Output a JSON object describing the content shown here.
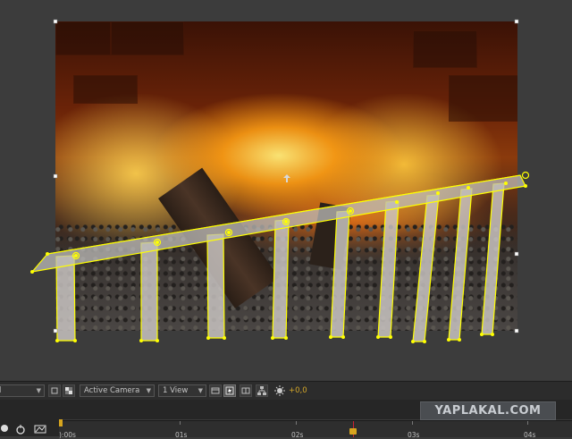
{
  "toolbar": {
    "resolution_value": "l",
    "view_layout_value": "Active Camera",
    "view_count_value": "1 View",
    "exposure_value": "+0,0",
    "icons": [
      "region-of-interest-icon",
      "transparency-grid-icon",
      "view-options-icon",
      "fast-preview-icon",
      "3d-view-icon",
      "flowchart-icon",
      "exposure-icon"
    ]
  },
  "timeline": {
    "ticks": [
      "):00s",
      "01s",
      "02s",
      "03s",
      "04s"
    ],
    "current_time_marker": "02s",
    "icons": [
      "live-update-icon",
      "draft-3d-icon",
      "graph-editor-icon"
    ]
  },
  "composition": {
    "scene": "fireplace-with-metal-grate",
    "overlay_color": "#ffff00"
  },
  "watermark": {
    "text": "YAPLAKAL.COM"
  }
}
